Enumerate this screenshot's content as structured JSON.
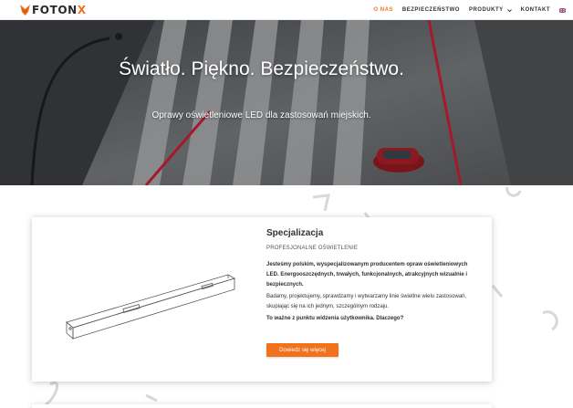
{
  "brand": {
    "name_main": "FOTON",
    "name_accent": "X",
    "accent_color": "#f2711c"
  },
  "nav": {
    "items": [
      {
        "label": "O NAS",
        "active": true
      },
      {
        "label": "BEZPIECZEŃSTWO",
        "active": false
      },
      {
        "label": "PRODUKTY",
        "active": false,
        "has_dropdown": true
      },
      {
        "label": "KONTAKT",
        "active": false
      }
    ],
    "language_icon": "uk-flag-icon"
  },
  "hero": {
    "title": "Światło. Piękno. Bezpieczeństwo.",
    "subtitle": "Oprawy oświetleniowe LED dla zastosowań miejskich."
  },
  "card": {
    "title": "Specjalizacja",
    "subtitle": "PROFESJONALNE OŚWIETLENIE",
    "paragraph_1": "Jesteśmy polskim, wyspecjalizowanym producentem opraw oświetleniowych LED. Energooszczędnych, trwałych, funkcjonalnych, atrakcyjnych wizualnie i bezpiecznych.",
    "paragraph_2": "Badamy, projektujemy, sprawdzamy i wytwarzamy linie świetlne wielu zastosowań, skupiając się na ich jednym, szczególnym rodzaju.",
    "paragraph_3": "To ważne z punktu widzenia użytkownika. Dlaczego?",
    "button_label": "Dowiedz się więcej",
    "product_image": "led-linear-luminaire-image"
  }
}
